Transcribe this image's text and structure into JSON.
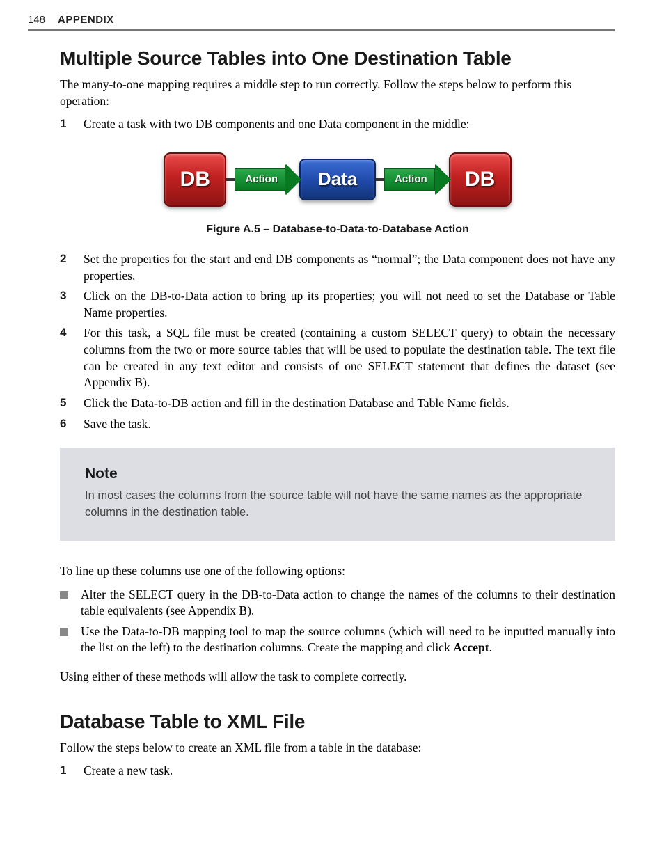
{
  "header": {
    "page_number": "148",
    "section": "APPENDIX"
  },
  "h1": "Multiple Source Tables into One Destination Table",
  "intro": "The many-to-one mapping requires a middle step to run correctly. Follow the steps below to perform this operation:",
  "steps1": {
    "n1": "1",
    "t1": "Create a task with two DB components and one Data component in the middle:"
  },
  "diagram": {
    "db": "DB",
    "action": "Action",
    "data": "Data"
  },
  "figure_caption": "Figure A.5 – Database-to-Data-to-Database Action",
  "steps2": {
    "n2": "2",
    "t2": "Set the properties for the start and end DB components as “normal”; the Data component does not have any properties.",
    "n3": "3",
    "t3": "Click on the DB-to-Data action to bring up its properties; you will not need to set the Database or Table Name properties.",
    "n4": "4",
    "t4": "For this task, a SQL file must be created (containing a custom SELECT query) to obtain the necessary columns from the two or more source tables that will be used to populate the destination table. The text file can be created in any text editor and consists of one SELECT statement that defines the dataset (see Appendix B).",
    "n5": "5",
    "t5": "Click the Data-to-DB action and fill in the destination Database and Table Name fields.",
    "n6": "6",
    "t6": "Save the task."
  },
  "note": {
    "title": "Note",
    "body": "In most cases the columns from the source table will not have the same names as the appropriate columns in the destination table."
  },
  "options_intro": "To line up these columns use one of the following options:",
  "options": {
    "a": "Alter the SELECT query in the DB-to-Data action to change the names of the columns to their destination table equivalents (see Appendix B).",
    "b_pre": "Use the Data-to-DB mapping tool to map the source columns (which will need to be inputted manually into the list on the left) to the destination columns. Create the mapping and click ",
    "b_bold": "Accept",
    "b_post": "."
  },
  "closing": "Using either of these methods will allow the task to complete correctly.",
  "h2": "Database Table to XML File",
  "intro2": "Follow the steps below to create an XML file from a table in the database:",
  "steps3": {
    "n1": "1",
    "t1": "Create a new task."
  }
}
